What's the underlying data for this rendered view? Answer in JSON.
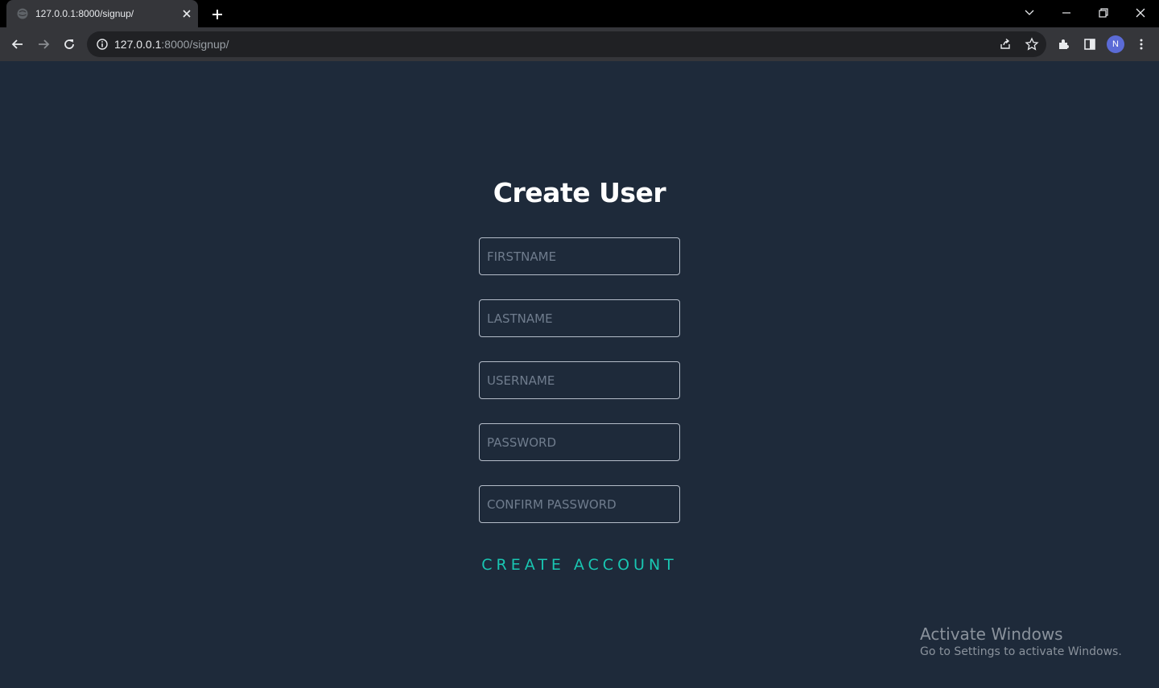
{
  "browser": {
    "tab_title": "127.0.0.1:8000/signup/",
    "url_host": "127.0.0.1",
    "url_rest": ":8000/signup/",
    "profile_initial": "N"
  },
  "form": {
    "title": "Create User",
    "fields": [
      {
        "placeholder": "FIRSTNAME",
        "value": ""
      },
      {
        "placeholder": "LASTNAME",
        "value": ""
      },
      {
        "placeholder": "USERNAME",
        "value": ""
      },
      {
        "placeholder": "PASSWORD",
        "value": ""
      },
      {
        "placeholder": "CONFIRM PASSWORD",
        "value": ""
      }
    ],
    "submit_label": "CREATE ACCOUNT"
  },
  "watermark": {
    "title": "Activate Windows",
    "subtitle": "Go to Settings to activate Windows."
  },
  "colors": {
    "page_background": "#1e2a3a",
    "accent": "#19c6b2"
  }
}
